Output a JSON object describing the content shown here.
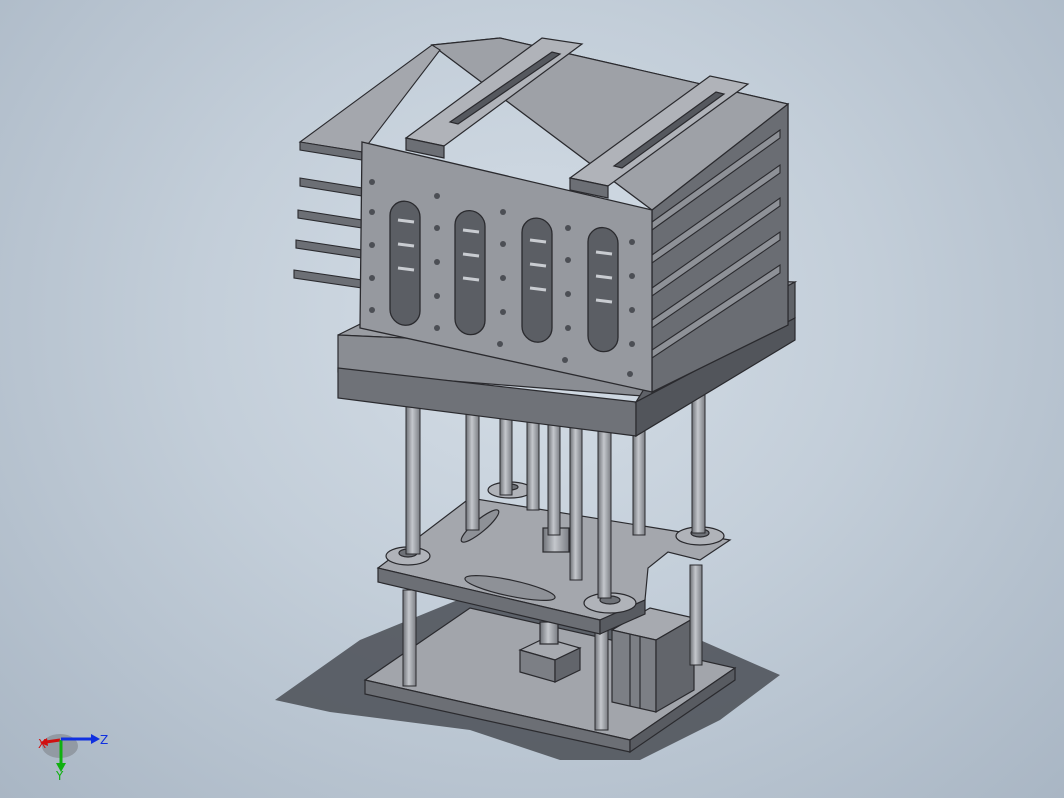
{
  "viewport": {
    "background_top": "#d4dde6",
    "background_bottom": "#a9b6c4",
    "part_color": "#8a8d93",
    "edge_color": "#2a2a2e"
  },
  "triad": {
    "x_label": "X",
    "y_label": "Y",
    "z_label": "Z",
    "x_color": "#d01010",
    "y_color": "#10b010",
    "z_color": "#1030e0"
  }
}
